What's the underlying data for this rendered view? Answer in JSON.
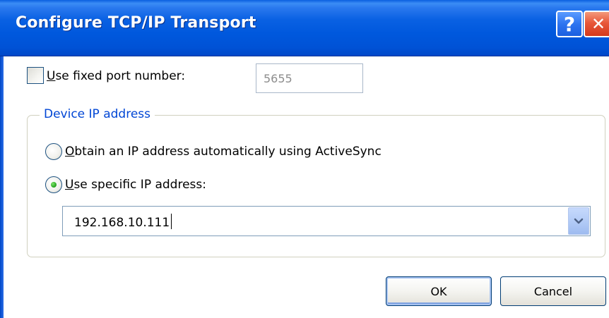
{
  "window": {
    "title": "Configure TCP/IP Transport",
    "help_label": "?",
    "close_label": "✕"
  },
  "port": {
    "checkbox_accel": "U",
    "checkbox_label_rest": "se fixed port number:",
    "checked": false,
    "value": "5655",
    "disabled": true
  },
  "device_ip": {
    "group_title": "Device IP address",
    "options": [
      {
        "accel": "O",
        "label_rest": "btain an IP address automatically using ActiveSync",
        "selected": false
      },
      {
        "accel": "U",
        "label_rest": "se specific IP address:",
        "selected": true
      }
    ],
    "ip_value": "192.168.10.111"
  },
  "buttons": {
    "ok": "OK",
    "cancel": "Cancel"
  },
  "colors": {
    "titlebar": "#0058dd",
    "group_title": "#0046d5",
    "radio_dot": "#2eaa26"
  }
}
